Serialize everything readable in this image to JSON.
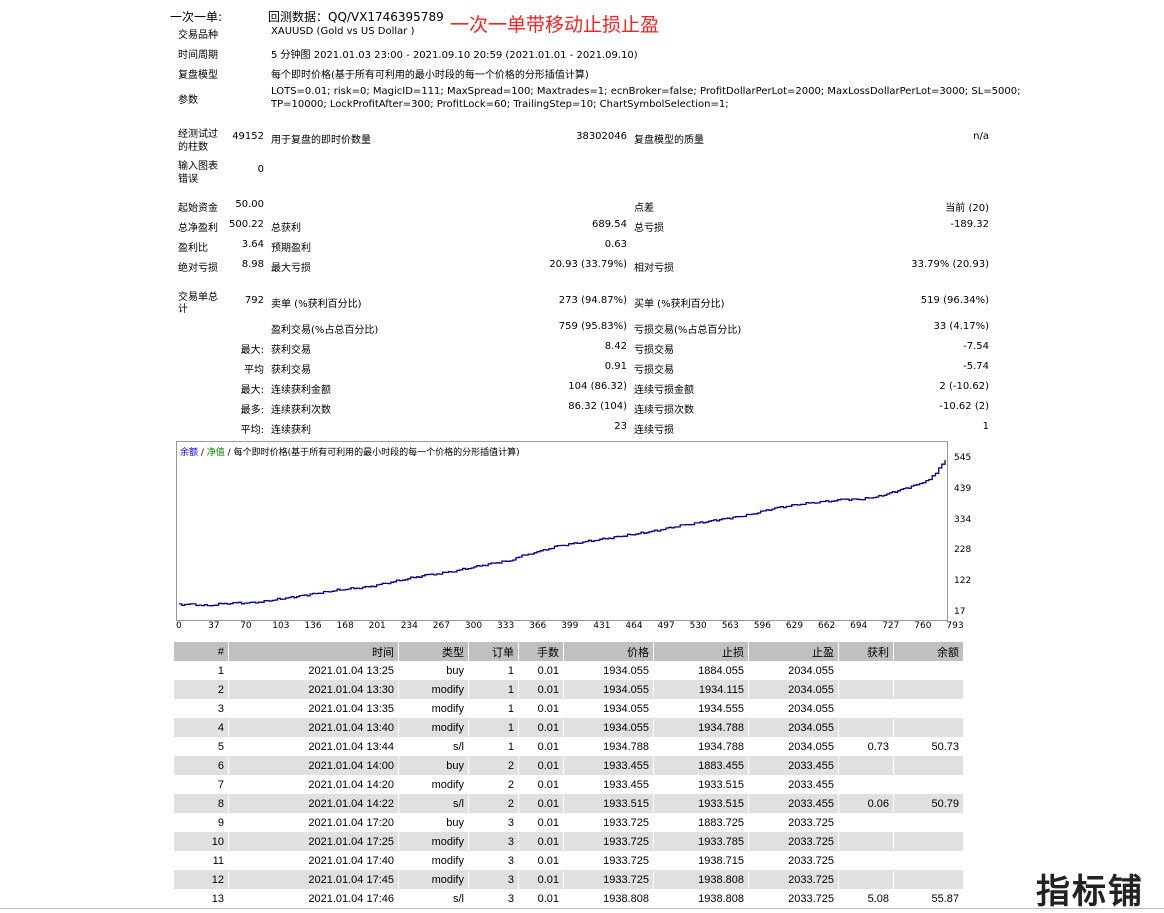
{
  "header": {
    "prefix": "一次一单:",
    "contact": "回测数据：QQ/VX1746395789",
    "red_title": "一次一单带移动止损止盈"
  },
  "info": [
    {
      "label": "交易品种",
      "value": "XAUUSD (Gold vs US Dollar )"
    },
    {
      "label": "时间周期",
      "value": "5 分钟图 2021.01.03 23:00 - 2021.09.10 20:59 (2021.01.01 - 2021.09.10)"
    },
    {
      "label": "复盘模型",
      "value": "每个即时价格(基于所有可利用的最小时段的每一个价格的分形插值计算)"
    },
    {
      "label": "参数",
      "value": "LOTS=0.01; risk=0; MagicID=111; MaxSpread=100; Maxtrades=1; ecnBroker=false; ProfitDollarPerLot=2000; MaxLossDollarPerLot=3000; SL=5000;",
      "value2": "TP=10000; LockProfitAfter=300; ProfitLock=60; TrailingStep=10; ChartSymbolSelection=1;"
    }
  ],
  "bars": {
    "label1": "经测试过",
    "label2": "的柱数",
    "value": "49152",
    "ticks_label": "用于复盘的即时价数量",
    "ticks_value": "38302046",
    "quality_label": "复盘模型的质量",
    "quality_value": "n/a"
  },
  "errors": {
    "label1": "输入图表",
    "label2": "错误",
    "value": "0"
  },
  "stats": {
    "deposit_label": "起始资金",
    "deposit": "50.00",
    "spread_label": "点差",
    "spread": "当前 (20)",
    "net_label": "总净盈利",
    "net": "500.22",
    "gross_profit_label": "总获利",
    "gross_profit": "689.54",
    "gross_loss_label": "总亏损",
    "gross_loss": "-189.32",
    "pf_label": "盈利比",
    "pf": "3.64",
    "payoff_label": "预期盈利",
    "payoff": "0.63",
    "abs_dd_label": "绝对亏损",
    "abs_dd": "8.98",
    "max_dd_label": "最大亏损",
    "max_dd": "20.93 (33.79%)",
    "rel_dd_label": "相对亏损",
    "rel_dd": "33.79% (20.93)",
    "total_label1": "交易单总",
    "total_label2": "计",
    "total": "792",
    "short_label": "卖单 (%获利百分比)",
    "short": "273 (94.87%)",
    "long_label": "买单 (%获利百分比)",
    "long": "519 (96.34%)",
    "win_label": "盈利交易(%占总百分比)",
    "win": "759 (95.83%)",
    "loss_label": "亏损交易(%占总百分比)",
    "loss": "33 (4.17%)",
    "largest_prefix": "最大:",
    "largest_win_label": "获利交易",
    "largest_win": "8.42",
    "largest_loss_label": "亏损交易",
    "largest_loss": "-7.54",
    "avg_prefix": "平均",
    "avg_win_label": "获利交易",
    "avg_win": "0.91",
    "avg_loss_label": "亏损交易",
    "avg_loss": "-5.74",
    "max_prefix": "最大:",
    "consec_win_amt_label": "连续获利金额",
    "consec_win_amt": "104 (86.32)",
    "consec_loss_amt_label": "连续亏损金额",
    "consec_loss_amt": "2 (-10.62)",
    "maxmore_prefix": "最多:",
    "consec_win_cnt_label": "连续获利次数",
    "consec_win_cnt": "86.32 (104)",
    "consec_loss_cnt_label": "连续亏损次数",
    "consec_loss_cnt": "-10.62 (2)",
    "avg2_prefix": "平均:",
    "avg_consec_win_label": "连续获利",
    "avg_consec_win": "23",
    "avg_consec_loss_label": "连续亏损",
    "avg_consec_loss": "1"
  },
  "chart_legend": {
    "balance": "余额",
    "sep1": " / ",
    "equity": "净值",
    "sep2": " / ",
    "model": "每个即时价格(基于所有可利用的最小时段的每一个价格的分形插值计算)"
  },
  "chart_data": {
    "type": "line",
    "title": "",
    "x_ticks": [
      "0",
      "37",
      "70",
      "103",
      "136",
      "168",
      "201",
      "234",
      "267",
      "300",
      "333",
      "366",
      "399",
      "431",
      "464",
      "497",
      "530",
      "563",
      "596",
      "629",
      "662",
      "694",
      "727",
      "760",
      "793"
    ],
    "y_ticks": [
      "545",
      "439",
      "334",
      "228",
      "122",
      "17"
    ],
    "ylim": [
      17,
      545
    ],
    "xlim": [
      0,
      810
    ],
    "series": [
      {
        "name": "余额",
        "color": "#00008b",
        "x": [
          0,
          15,
          30,
          45,
          60,
          75,
          90,
          110,
          130,
          150,
          170,
          185,
          200,
          230,
          260,
          285,
          300,
          330,
          350,
          366,
          385,
          400,
          430,
          460,
          480,
          500,
          530,
          560,
          580,
          600,
          630,
          660,
          690,
          700,
          720,
          740,
          760,
          780,
          793,
          800,
          810
        ],
        "y": [
          50,
          50,
          45,
          52,
          55,
          55,
          60,
          70,
          80,
          90,
          100,
          105,
          110,
          130,
          150,
          160,
          170,
          190,
          200,
          220,
          235,
          250,
          265,
          280,
          290,
          300,
          320,
          335,
          345,
          355,
          380,
          395,
          405,
          410,
          410,
          420,
          440,
          460,
          480,
          500,
          545
        ]
      }
    ]
  },
  "trades": {
    "headers": [
      "#",
      "时间",
      "类型",
      "订单",
      "手数",
      "价格",
      "止损",
      "止盈",
      "获利",
      "余额"
    ],
    "rows": [
      [
        "1",
        "2021.01.04 13:25",
        "buy",
        "1",
        "0.01",
        "1934.055",
        "1884.055",
        "2034.055",
        "",
        ""
      ],
      [
        "2",
        "2021.01.04 13:30",
        "modify",
        "1",
        "0.01",
        "1934.055",
        "1934.115",
        "2034.055",
        "",
        ""
      ],
      [
        "3",
        "2021.01.04 13:35",
        "modify",
        "1",
        "0.01",
        "1934.055",
        "1934.555",
        "2034.055",
        "",
        ""
      ],
      [
        "4",
        "2021.01.04 13:40",
        "modify",
        "1",
        "0.01",
        "1934.055",
        "1934.788",
        "2034.055",
        "",
        ""
      ],
      [
        "5",
        "2021.01.04 13:44",
        "s/l",
        "1",
        "0.01",
        "1934.788",
        "1934.788",
        "2034.055",
        "0.73",
        "50.73"
      ],
      [
        "6",
        "2021.01.04 14:00",
        "buy",
        "2",
        "0.01",
        "1933.455",
        "1883.455",
        "2033.455",
        "",
        ""
      ],
      [
        "7",
        "2021.01.04 14:20",
        "modify",
        "2",
        "0.01",
        "1933.455",
        "1933.515",
        "2033.455",
        "",
        ""
      ],
      [
        "8",
        "2021.01.04 14:22",
        "s/l",
        "2",
        "0.01",
        "1933.515",
        "1933.515",
        "2033.455",
        "0.06",
        "50.79"
      ],
      [
        "9",
        "2021.01.04 17:20",
        "buy",
        "3",
        "0.01",
        "1933.725",
        "1883.725",
        "2033.725",
        "",
        ""
      ],
      [
        "10",
        "2021.01.04 17:25",
        "modify",
        "3",
        "0.01",
        "1933.725",
        "1933.785",
        "2033.725",
        "",
        ""
      ],
      [
        "11",
        "2021.01.04 17:40",
        "modify",
        "3",
        "0.01",
        "1933.725",
        "1938.715",
        "2033.725",
        "",
        ""
      ],
      [
        "12",
        "2021.01.04 17:45",
        "modify",
        "3",
        "0.01",
        "1933.725",
        "1938.808",
        "2033.725",
        "",
        ""
      ],
      [
        "13",
        "2021.01.04 17:46",
        "s/l",
        "3",
        "0.01",
        "1938.808",
        "1938.808",
        "2033.725",
        "5.08",
        "55.87"
      ]
    ]
  },
  "watermark": "指标铺"
}
